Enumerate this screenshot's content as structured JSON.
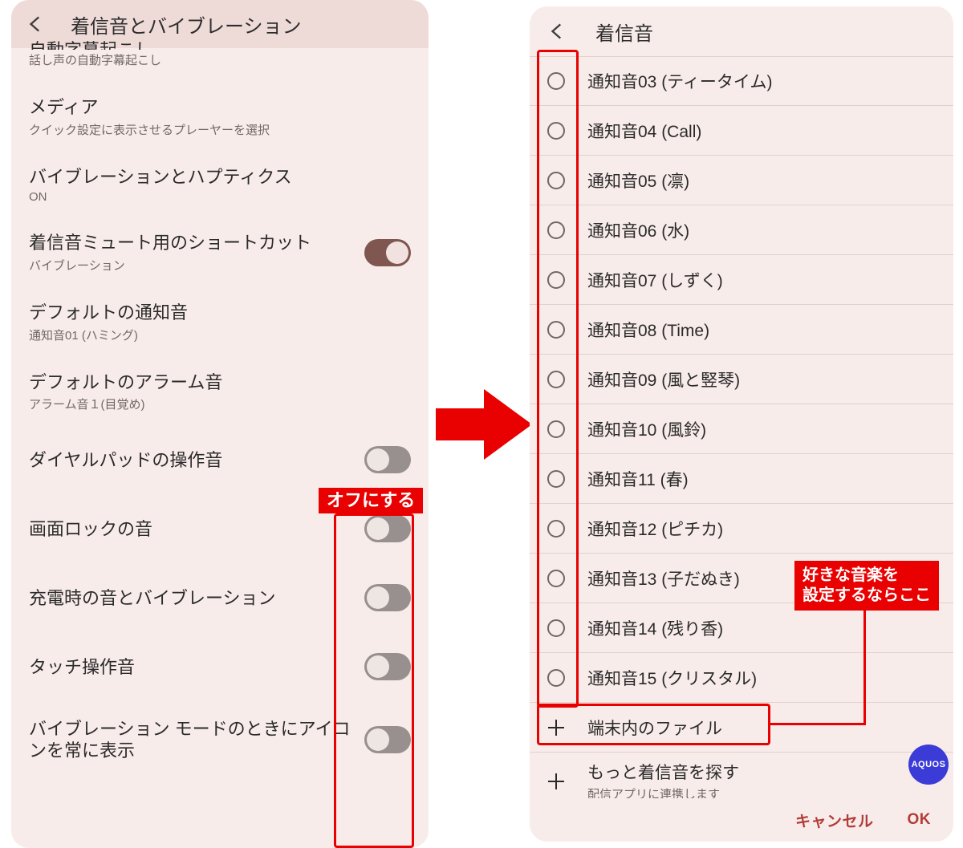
{
  "left": {
    "header_title": "着信音とバイブレーション",
    "items": [
      {
        "title": "自動字幕起こし",
        "sub": "話し声の自動字幕起こし",
        "partial": true
      },
      {
        "title": "メディア",
        "sub": "クイック設定に表示させるプレーヤーを選択"
      },
      {
        "title": "バイブレーションとハプティクス",
        "sub": "ON"
      },
      {
        "title": "着信音ミュート用のショートカット",
        "sub": "バイブレーション",
        "toggle": "on"
      },
      {
        "title": "デフォルトの通知音",
        "sub": "通知音01 (ハミング)"
      },
      {
        "title": "デフォルトのアラーム音",
        "sub": "アラーム音１(目覚め)"
      }
    ],
    "toggle_rows": [
      {
        "label": "ダイヤルパッドの操作音"
      },
      {
        "label": "画面ロックの音"
      },
      {
        "label": "充電時の音とバイブレーション"
      },
      {
        "label": "タッチ操作音"
      },
      {
        "label": "バイブレーション モードのときにアイコンを常に表示"
      }
    ],
    "annotation_off": "オフにする"
  },
  "right": {
    "header_title": "着信音",
    "ringtones": [
      "通知音03 (ティータイム)",
      "通知音04 (Call)",
      "通知音05 (凛)",
      "通知音06 (水)",
      "通知音07 (しずく)",
      "通知音08 (Time)",
      "通知音09 (風と竪琴)",
      "通知音10 (風鈴)",
      "通知音11 (春)",
      "通知音12 (ピチカ)",
      "通知音13 (子だぬき)",
      "通知音14 (残り香)",
      "通知音15 (クリスタル)"
    ],
    "add_file_label": "端末内のファイル",
    "more_title": "もっと着信音を探す",
    "more_sub": "配信アプリに連携します",
    "footer_cancel": "キャンセル",
    "footer_ok": "OK",
    "aquos_label": "AQUOS",
    "annotation_music": "好きな音楽を\n設定するならここ"
  }
}
